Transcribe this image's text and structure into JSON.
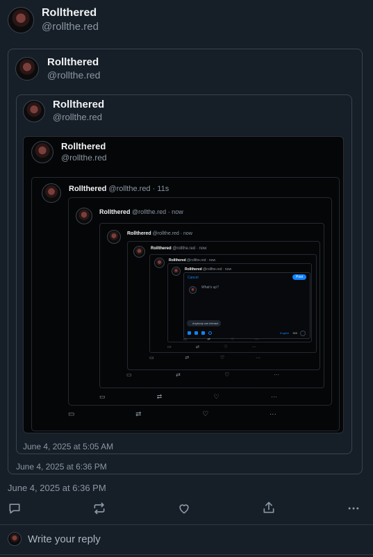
{
  "post": {
    "name": "Rollthered",
    "handle": "@rollthe.red",
    "timestamp": "June 4, 2025 at 6:36 PM"
  },
  "quote1": {
    "name": "Rollthered",
    "handle": "@rollthe.red",
    "timestamp": "June 4, 2025 at 6:36 PM"
  },
  "quote2": {
    "name": "Rollthered",
    "handle": "@rollthe.red",
    "timestamp": "June 4, 2025 at 5:05 AM"
  },
  "screenshot": {
    "header_name": "Rollthered",
    "header_handle": "@rollthe.red",
    "levels": [
      {
        "name": "Rollthered",
        "meta": "@rollthe.red · 11s"
      },
      {
        "name": "Rollthered",
        "meta": "@rollthe.red · now"
      },
      {
        "name": "Rollthered",
        "meta": "@rollthe.red · now"
      },
      {
        "name": "Rollthered",
        "meta": "@rollthe.red · now"
      },
      {
        "name": "Rollthered",
        "meta": "@rollthe.red · now"
      },
      {
        "name": "Rollthered",
        "meta": "@rollthe.red · now"
      }
    ],
    "composer": {
      "cancel": "Cancel",
      "post": "Post",
      "placeholder": "What's up?",
      "interaction_pill": "Anybody can interact",
      "language": "English",
      "count": "300"
    }
  },
  "actions": {
    "reply": "reply-icon",
    "repost": "repost-icon",
    "like": "heart-icon",
    "share": "share-icon",
    "more": "more-icon"
  },
  "reply_bar": {
    "placeholder": "Write your reply"
  },
  "colors": {
    "background": "#161e27",
    "border": "#3a4452",
    "muted": "#8b98a5",
    "accent": "#1083fe"
  }
}
